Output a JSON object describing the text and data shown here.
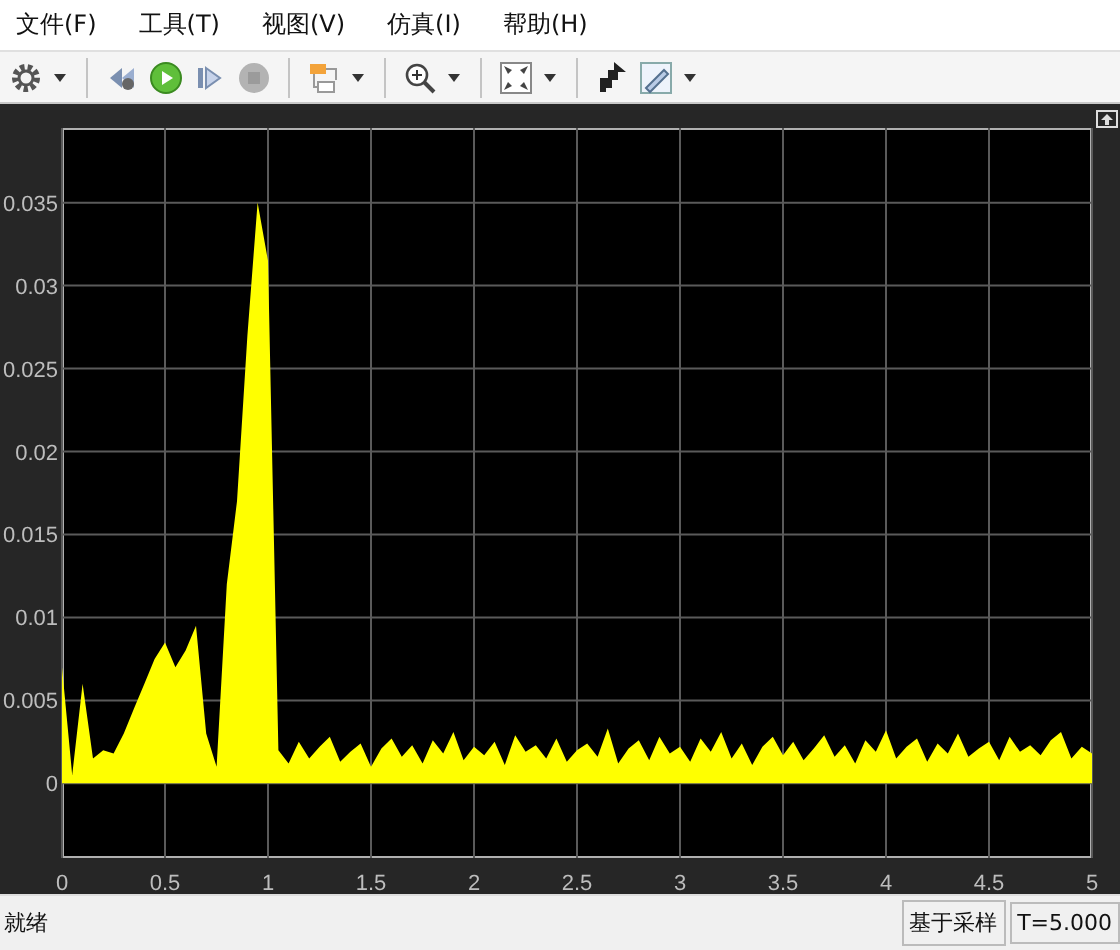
{
  "menu": [
    {
      "label": "文件(F)"
    },
    {
      "label": "工具(T)"
    },
    {
      "label": "视图(V)"
    },
    {
      "label": "仿真(I)"
    },
    {
      "label": "帮助(H)"
    }
  ],
  "toolbar": [
    [
      {
        "kind": "settings",
        "dropdown": true,
        "disabled": false
      }
    ],
    [
      {
        "kind": "step-back",
        "dropdown": false,
        "disabled": false
      },
      {
        "kind": "run",
        "dropdown": false,
        "disabled": false
      },
      {
        "kind": "step-forward",
        "dropdown": false,
        "disabled": false
      },
      {
        "kind": "stop",
        "dropdown": false,
        "disabled": true
      }
    ],
    [
      {
        "kind": "signal",
        "dropdown": true,
        "disabled": false
      }
    ],
    [
      {
        "kind": "zoom",
        "dropdown": true,
        "disabled": false
      }
    ],
    [
      {
        "kind": "fit",
        "dropdown": true,
        "disabled": false
      }
    ],
    [
      {
        "kind": "highlight",
        "dropdown": false,
        "disabled": false
      },
      {
        "kind": "style",
        "dropdown": true,
        "disabled": false
      }
    ]
  ],
  "plot": {
    "chart_data": {
      "type": "area",
      "x": [
        0,
        0.05,
        0.1,
        0.15,
        0.2,
        0.25,
        0.3,
        0.35,
        0.4,
        0.45,
        0.5,
        0.55,
        0.6,
        0.65,
        0.7,
        0.75,
        0.8,
        0.85,
        0.9,
        0.95,
        1,
        1.05,
        1.1,
        1.15,
        1.2,
        1.25,
        1.3,
        1.35,
        1.4,
        1.45,
        1.5,
        1.55,
        1.6,
        1.65,
        1.7,
        1.75,
        1.8,
        1.85,
        1.9,
        1.95,
        2,
        2.05,
        2.1,
        2.15,
        2.2,
        2.25,
        2.3,
        2.35,
        2.4,
        2.45,
        2.5,
        2.55,
        2.6,
        2.65,
        2.7,
        2.75,
        2.8,
        2.85,
        2.9,
        2.95,
        3,
        3.05,
        3.1,
        3.15,
        3.2,
        3.25,
        3.3,
        3.35,
        3.4,
        3.45,
        3.5,
        3.55,
        3.6,
        3.65,
        3.7,
        3.75,
        3.8,
        3.85,
        3.9,
        3.95,
        4,
        4.05,
        4.1,
        4.15,
        4.2,
        4.25,
        4.3,
        4.35,
        4.4,
        4.45,
        4.5,
        4.55,
        4.6,
        4.65,
        4.7,
        4.75,
        4.8,
        4.85,
        4.9,
        4.95,
        5
      ],
      "series": [
        {
          "color": "#ffff00",
          "values": [
            0.007,
            0.0005,
            0.006,
            0.0015,
            0.002,
            0.0018,
            0.003,
            0.0045,
            0.006,
            0.0075,
            0.0085,
            0.007,
            0.008,
            0.0095,
            0.003,
            0.001,
            0.012,
            0.017,
            0.027,
            0.035,
            0.0315,
            0.002,
            0.0012,
            0.0025,
            0.0015,
            0.0022,
            0.0028,
            0.0013,
            0.0019,
            0.0024,
            0.001,
            0.0021,
            0.0027,
            0.0016,
            0.0023,
            0.0012,
            0.0026,
            0.0018,
            0.0031,
            0.0014,
            0.0022,
            0.0017,
            0.0025,
            0.0011,
            0.0029,
            0.0019,
            0.0023,
            0.0015,
            0.0027,
            0.0013,
            0.002,
            0.0024,
            0.0016,
            0.0033,
            0.0012,
            0.0021,
            0.0026,
            0.0014,
            0.0028,
            0.0018,
            0.0022,
            0.0013,
            0.0027,
            0.0019,
            0.0031,
            0.0015,
            0.0024,
            0.0011,
            0.0022,
            0.0028,
            0.0017,
            0.0025,
            0.0014,
            0.0021,
            0.0029,
            0.0016,
            0.0023,
            0.0012,
            0.0026,
            0.0019,
            0.0032,
            0.0015,
            0.0022,
            0.0027,
            0.0013,
            0.0024,
            0.0018,
            0.003,
            0.0016,
            0.0021,
            0.0025,
            0.0014,
            0.0028,
            0.0019,
            0.0023,
            0.0017,
            0.0026,
            0.0031,
            0.0015,
            0.0022,
            0.0018
          ]
        }
      ],
      "grid": true,
      "xlim": [
        0,
        5
      ],
      "ylim": [
        -0.0045,
        0.0395
      ],
      "xticks": [
        0,
        0.5,
        1,
        1.5,
        2,
        2.5,
        3,
        3.5,
        4,
        4.5,
        5
      ],
      "yticks": [
        0,
        0.005,
        0.01,
        0.015,
        0.02,
        0.025,
        0.03,
        0.035
      ]
    }
  },
  "status_bar": {
    "text": "就绪",
    "panes": [
      {
        "text": "基于采样"
      },
      {
        "text": "T=5.000"
      }
    ]
  }
}
